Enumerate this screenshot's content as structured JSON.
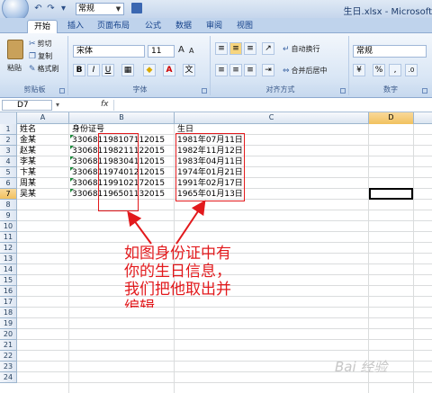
{
  "window": {
    "title": "生日.xlsx - Microsoft",
    "qat_font": "常规"
  },
  "tabs": [
    {
      "label": "开始",
      "active": true
    },
    {
      "label": "插入",
      "active": false
    },
    {
      "label": "页面布局",
      "active": false
    },
    {
      "label": "公式",
      "active": false
    },
    {
      "label": "数据",
      "active": false
    },
    {
      "label": "审阅",
      "active": false
    },
    {
      "label": "视图",
      "active": false
    }
  ],
  "ribbon": {
    "clipboard": {
      "paste": "粘贴",
      "cut": "剪切",
      "copy": "复制",
      "format_painter": "格式刷",
      "group_label": "剪贴板"
    },
    "font": {
      "font_name": "宋体",
      "font_size": "11",
      "grow": "A",
      "shrink": "A",
      "bold": "B",
      "italic": "I",
      "underline": "U",
      "color_a": "A",
      "group_label": "字体",
      "wen": "文"
    },
    "alignment": {
      "wrap": "自动换行",
      "merge": "合并后居中",
      "group_label": "对齐方式"
    },
    "number": {
      "format": "常规",
      "percent": "%",
      "comma": ",",
      "group_label": "数字"
    }
  },
  "formula_bar": {
    "name_box": "D7",
    "fx": "fx",
    "content": ""
  },
  "columns": [
    "A",
    "B",
    "C",
    "D"
  ],
  "selected_column": "D",
  "rows": [
    "1",
    "2",
    "3",
    "4",
    "5",
    "6",
    "7",
    "8",
    "9",
    "10",
    "11",
    "12",
    "13",
    "14",
    "15",
    "16",
    "17",
    "18",
    "19",
    "20",
    "21",
    "22",
    "23",
    "24"
  ],
  "selected_row": "7",
  "sheet": {
    "headers": {
      "name": "姓名",
      "id": "身份证号",
      "birthday": "生日"
    },
    "records": [
      {
        "name": "金某",
        "id": "330681198107112015",
        "birthday": "1981年07月11日"
      },
      {
        "name": "赵某",
        "id": "330681198211122015",
        "birthday": "1982年11月12日"
      },
      {
        "name": "李某",
        "id": "330681198304112015",
        "birthday": "1983年04月11日"
      },
      {
        "name": "卞某",
        "id": "330681197401212015",
        "birthday": "1974年01月21日"
      },
      {
        "name": "周某",
        "id": "330681199102172015",
        "birthday": "1991年02月17日"
      },
      {
        "name": "吴某",
        "id": "330681196501132015",
        "birthday": "1965年01月13日"
      }
    ]
  },
  "annotation": [
    "如图身份证中有",
    "你的生日信息，",
    "我们把他取出并",
    "编辑"
  ],
  "colors": {
    "annotation_red": "#e2191c",
    "ribbon_blue": "#15428b",
    "selection_gold": "#f1c15f"
  },
  "watermark": "Bai 经验"
}
